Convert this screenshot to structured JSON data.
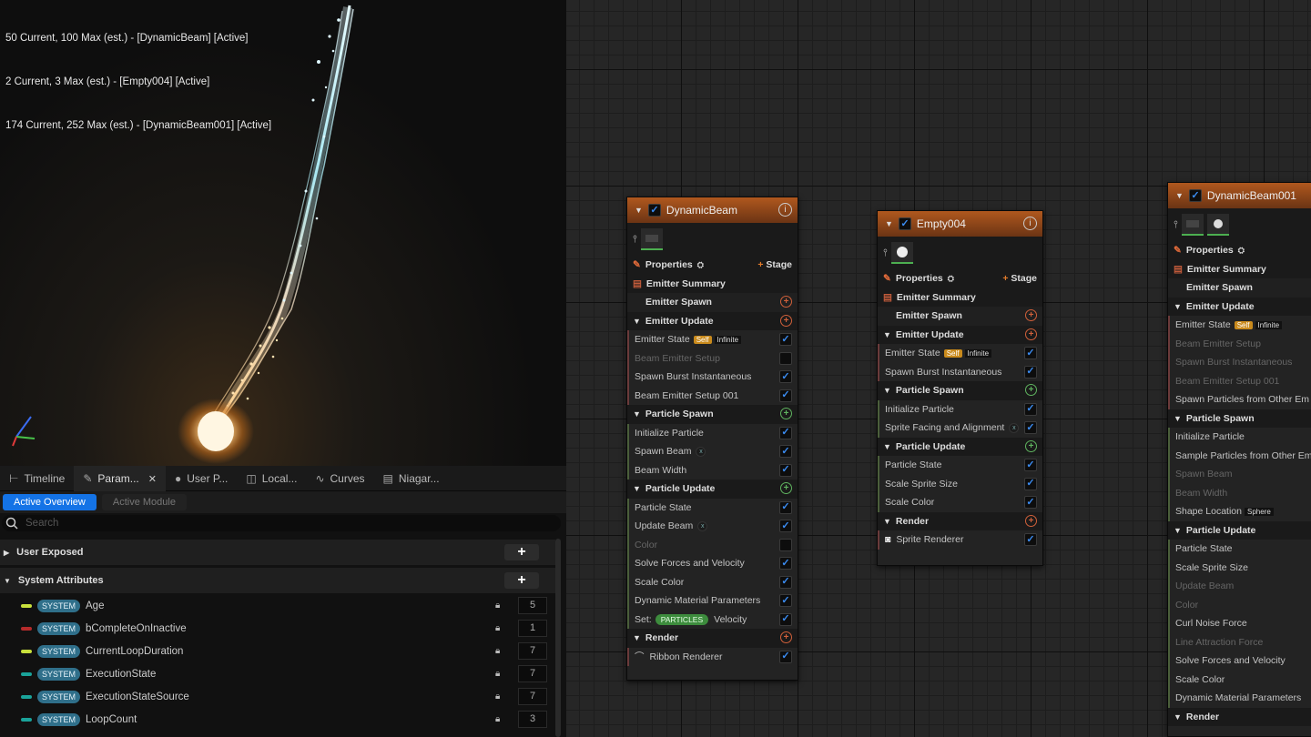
{
  "viewport": {
    "stats": [
      "50 Current, 100 Max (est.) - [DynamicBeam] [Active]",
      "2 Current, 3 Max (est.) - [Empty004] [Active]",
      "174 Current, 252 Max (est.) - [DynamicBeam001] [Active]"
    ]
  },
  "tabs": [
    {
      "label": "Timeline",
      "icon": "timeline-icon"
    },
    {
      "label": "Param...",
      "icon": "parameters-icon"
    },
    {
      "label": "User P...",
      "icon": "user-icon"
    },
    {
      "label": "Local...",
      "icon": "local-icon"
    },
    {
      "label": "Curves",
      "icon": "curves-icon"
    },
    {
      "label": "Niagar...",
      "icon": "niagara-icon"
    }
  ],
  "subtabs": {
    "overview": "Active Overview",
    "module": "Active Module"
  },
  "search": {
    "placeholder": "Search"
  },
  "params": {
    "user_exposed": "User Exposed",
    "system_attributes": "System Attributes",
    "tag": "SYSTEM",
    "rows": [
      {
        "name": "Age",
        "value": "5",
        "color": "#c8e03c"
      },
      {
        "name": "bCompleteOnInactive",
        "value": "1",
        "color": "#b52b2b"
      },
      {
        "name": "CurrentLoopDuration",
        "value": "7",
        "color": "#c8e03c"
      },
      {
        "name": "ExecutionState",
        "value": "7",
        "color": "#1aa39a"
      },
      {
        "name": "ExecutionStateSource",
        "value": "7",
        "color": "#1aa39a"
      },
      {
        "name": "LoopCount",
        "value": "3",
        "color": "#1aa39a"
      }
    ]
  },
  "nodes": {
    "common": {
      "properties": "Properties",
      "stage": "Stage",
      "emitter_summary": "Emitter Summary",
      "emitter_spawn": "Emitter Spawn",
      "emitter_update": "Emitter Update",
      "emitter_state": "Emitter State",
      "self": "Self",
      "infinite": "Infinite",
      "particle_spawn": "Particle Spawn",
      "particle_update": "Particle Update",
      "render": "Render",
      "set": "Set:",
      "particles": "PARTICLES",
      "velocity": "Velocity",
      "shape_loc": "Shape Location",
      "sphere": "Sphere"
    },
    "n1": {
      "title": "DynamicBeam",
      "emitter_update": [
        "Beam Emitter Setup",
        "Spawn Burst Instantaneous",
        "Beam Emitter Setup 001"
      ],
      "particle_spawn": [
        "Initialize Particle",
        "Spawn Beam",
        "Beam Width"
      ],
      "particle_update": [
        "Particle State",
        "Update Beam",
        "Color",
        "Solve Forces and Velocity",
        "Scale Color",
        "Dynamic Material Parameters"
      ],
      "render": "Ribbon Renderer"
    },
    "n2": {
      "title": "Empty004",
      "emitter_update": [
        "Spawn Burst Instantaneous"
      ],
      "particle_spawn": [
        "Initialize Particle",
        "Sprite Facing and Alignment"
      ],
      "particle_update": [
        "Particle State",
        "Scale Sprite Size",
        "Scale Color"
      ],
      "render": "Sprite Renderer"
    },
    "n3": {
      "title": "DynamicBeam001",
      "emitter_update": [
        "Beam Emitter Setup",
        "Spawn Burst Instantaneous",
        "Beam Emitter Setup 001",
        "Spawn Particles from Other Em"
      ],
      "particle_spawn": [
        "Initialize Particle",
        "Sample Particles from Other Em",
        "Spawn Beam",
        "Beam Width"
      ],
      "particle_update": [
        "Particle State",
        "Scale Sprite Size",
        "Update Beam",
        "Color",
        "Curl Noise Force",
        "Line Attraction Force",
        "Solve Forces and Velocity",
        "Scale Color",
        "Dynamic Material Parameters"
      ],
      "render": "Render"
    }
  }
}
